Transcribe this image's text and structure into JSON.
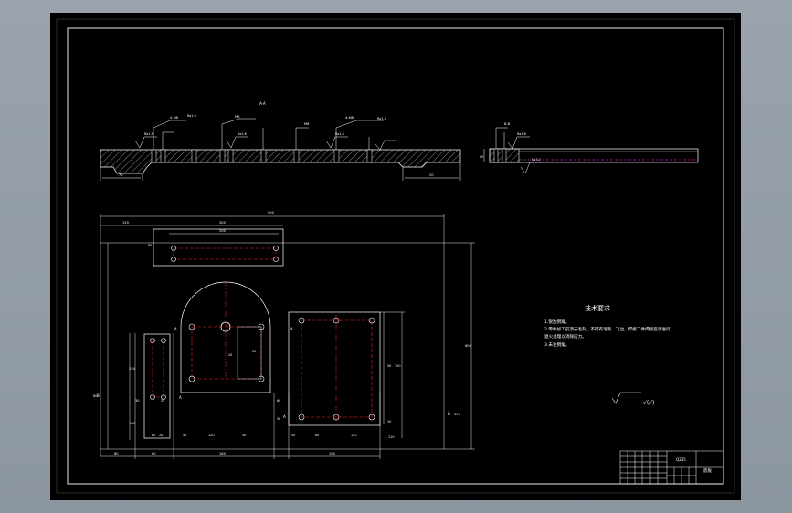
{
  "sheet": {
    "background_color": "#000000",
    "frame_color": "#ffffff",
    "hatch_color": "#b0b0b0",
    "centerline_color": "#ff2020",
    "hidden_line_color": "#ff33ff"
  },
  "section_view": {
    "label": "A-A",
    "surface_marks": [
      "Ra1.6",
      "Ra1.6",
      "Ra1.6",
      "Ra1.6",
      "Ra1.6"
    ],
    "hole_callouts": [
      "4-M8",
      "M8",
      "M8",
      "4-M8"
    ],
    "bottom_dims": [
      "70",
      "20"
    ]
  },
  "side_view": {
    "label": "B-B",
    "surface_marks": [
      "Ra1.6",
      "Ra3.2"
    ],
    "thickness_dim": "20"
  },
  "plan_view": {
    "overall_width": "900",
    "top_dims": [
      "150",
      "300",
      "200"
    ],
    "right_dims": [
      "600",
      "350"
    ],
    "left_dims": [
      "60",
      "150",
      "30",
      "100",
      "80"
    ],
    "bottom_dims": [
      "60",
      "60",
      "160",
      "100",
      "110"
    ],
    "inner_dims": [
      "20",
      "50",
      "120",
      "30",
      "50",
      "50",
      "60",
      "120",
      "150",
      "50",
      "30",
      "20",
      "10",
      "60",
      "60",
      "15"
    ],
    "section_marks": [
      "A",
      "A",
      "A",
      "A",
      "B",
      "B"
    ]
  },
  "tech_notes": {
    "title": "技术要求",
    "lines": [
      "1.锐边倒角。",
      "2.零件加工前须去毛刺，不得有毛刺、飞边。焊接工件焊接后须进行",
      "退火处理以消除应力。",
      "3.未注倒角。"
    ]
  },
  "roughness_symbol": "√(√)",
  "title_block": {
    "part_name": "底板",
    "material": "Q235"
  }
}
